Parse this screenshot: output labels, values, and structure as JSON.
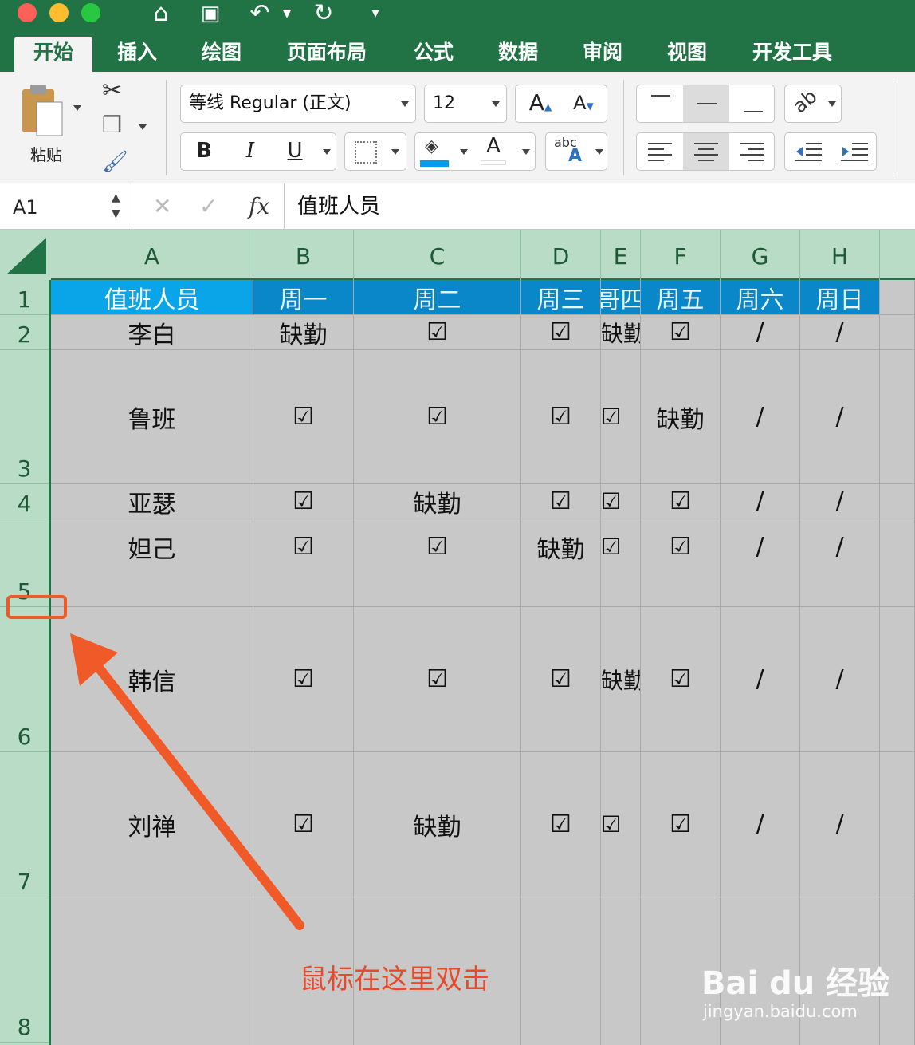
{
  "quick_access": {
    "home_icon": "home-icon",
    "save_icon": "save-icon",
    "undo_icon": "undo-icon",
    "redo_icon": "redo-icon",
    "customize_icon": "customize-icon"
  },
  "tabs": [
    "开始",
    "插入",
    "绘图",
    "页面布局",
    "公式",
    "数据",
    "审阅",
    "视图",
    "开发工具"
  ],
  "ribbon": {
    "paste_label": "粘贴",
    "font_name": "等线 Regular (正文)",
    "font_size": "12",
    "bold": "B",
    "italic": "I",
    "underline": "U",
    "grow_font": "A",
    "shrink_font": "A",
    "font_color": "A",
    "abc": "abc",
    "abc_a": "A"
  },
  "formula_bar": {
    "name_box": "A1",
    "fx": "fx",
    "content": "值班人员"
  },
  "columns": [
    "A",
    "B",
    "C",
    "D",
    "E",
    "F",
    "G",
    "H"
  ],
  "rows": [
    "1",
    "2",
    "3",
    "4",
    "5",
    "6",
    "7",
    "8"
  ],
  "table": {
    "header": [
      "值班人员",
      "周一",
      "周二",
      "周三",
      "周四",
      "周五",
      "周六",
      "周日"
    ],
    "header_visible": [
      "值班人员",
      "周一",
      "周二",
      "周三",
      "哥四",
      "周五",
      "周六",
      "周日"
    ],
    "data": [
      [
        "李白",
        "缺勤",
        "☑",
        "☑",
        "缺勤",
        "☑",
        "/",
        "/"
      ],
      [
        "鲁班",
        "☑",
        "☑",
        "☑",
        "☑",
        "缺勤",
        "/",
        "/"
      ],
      [
        "亚瑟",
        "☑",
        "缺勤",
        "☑",
        "☑",
        "☑",
        "/",
        "/"
      ],
      [
        "妲己",
        "☑",
        "☑",
        "缺勤",
        "☑",
        "☑",
        "/",
        "/"
      ],
      [
        "韩信",
        "☑",
        "☑",
        "☑",
        "缺勤",
        "☑",
        "/",
        "/"
      ],
      [
        "刘禅",
        "☑",
        "缺勤",
        "☑",
        "☑",
        "☑",
        "/",
        "/"
      ]
    ]
  },
  "annotation": "鼠标在这里双击",
  "watermark": {
    "brand": "Bai du 经验",
    "url": "jingyan.baidu.com"
  },
  "colors": {
    "excel_green": "#217346",
    "header_blue": "#0a87c8",
    "annotation_red": "#e8492a"
  }
}
